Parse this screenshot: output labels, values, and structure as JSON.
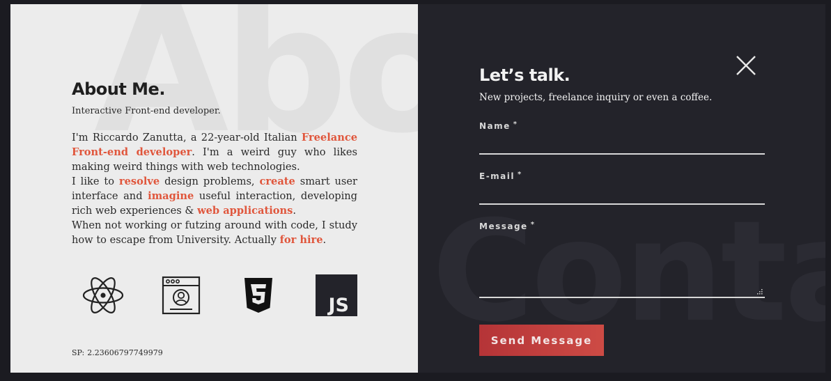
{
  "about": {
    "bg_word": "Abou",
    "title": "About Me.",
    "subtitle": "Interactive Front-end developer.",
    "bio": {
      "p1_a": "I'm Riccardo Zanutta, a 22-year-old Italian ",
      "p1_hl": "Freelance Front-end developer",
      "p1_b": ". I'm a weird guy who likes making weird things with web technologies.",
      "p2_a": "I like to ",
      "p2_hl1": "resolve",
      "p2_b": " design problems, ",
      "p2_hl2": "create",
      "p2_c": " smart user interface and ",
      "p2_hl3": "imagine",
      "p2_d": " useful interaction, developing rich web experiences & ",
      "p2_hl4": "web applications",
      "p2_e": ".",
      "p3_a": "When not working or futzing around with code, I study how to escape from University. Actually ",
      "p3_hl": "for hire",
      "p3_b": "."
    },
    "icons": [
      "react-icon",
      "web-profile-icon",
      "css3-icon",
      "javascript-icon"
    ],
    "js_label": "JS",
    "sp_label": "SP:",
    "sp_value": "2.23606797749979"
  },
  "contact": {
    "bg_word": "Conta",
    "title": "Let’s talk.",
    "tagline": "New projects, freelance inquiry or even a coffee.",
    "fields": {
      "name_label": "Name",
      "email_label": "E-mail",
      "message_label": "Message",
      "required_mark": "*"
    },
    "send_label": "Send Message"
  },
  "colors": {
    "accent": "#e0563c",
    "button": "#c0403e",
    "dark_panel": "#23232a",
    "light_panel": "#ececec"
  }
}
